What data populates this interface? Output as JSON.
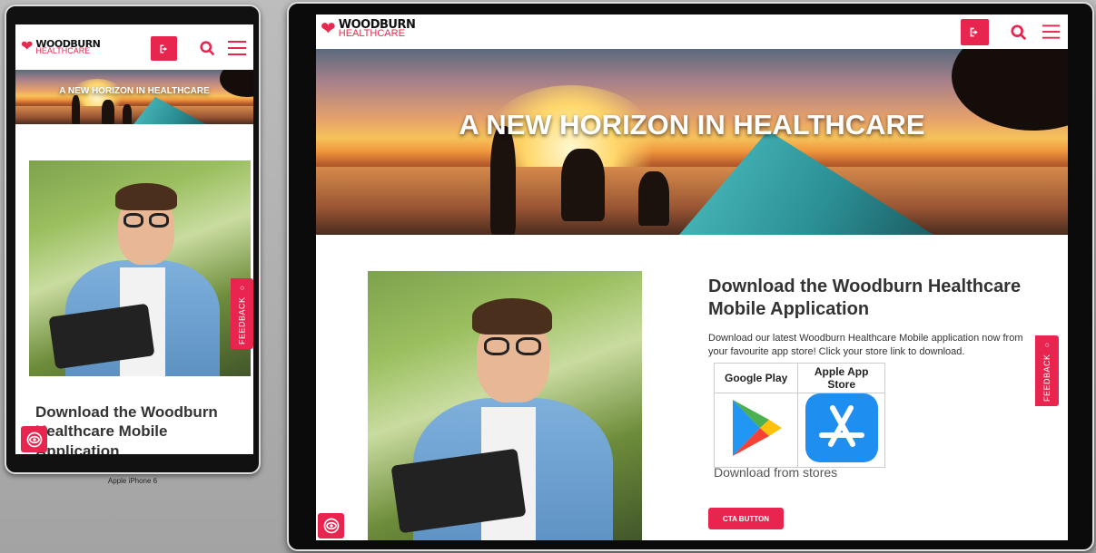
{
  "site": {
    "logo_top": "WOODBURN",
    "logo_bottom": "HEALTHCARE",
    "hero_title": "A NEW HORIZON IN HEALTHCARE"
  },
  "download": {
    "title": "Download the Woodburn Healthcare Mobile Application",
    "body": "Download our latest Woodburn Healthcare Mobile application now from your favourite app store! Click your store link to download.",
    "store_headers": [
      "Google Play",
      "Apple App Store"
    ],
    "caption": "Download from stores",
    "cta_label": "CTA BUTTON"
  },
  "feedback_label": "FEEDBACK",
  "phone_caption": "Apple iPhone 6",
  "colors": {
    "accent": "#e8254f",
    "logo_red": "#e52b50"
  },
  "icons": [
    "login-icon",
    "search-icon",
    "menu-icon",
    "eye-icon",
    "chat-icon",
    "google-play-icon",
    "app-store-icon",
    "heart-icon"
  ]
}
